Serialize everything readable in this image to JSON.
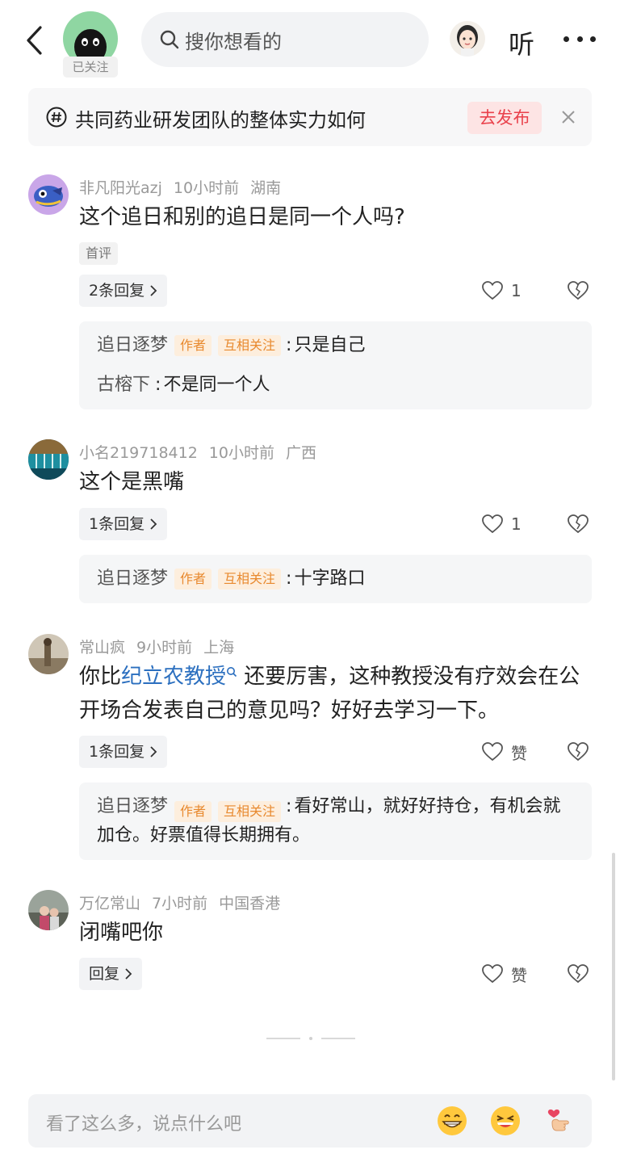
{
  "header": {
    "follow_badge": "已关注",
    "search_placeholder": "搜你想看的",
    "listen_label": "听"
  },
  "topic": {
    "text": "共同药业研发团队的整体实力如何",
    "publish_label": "去发布"
  },
  "comments": [
    {
      "author": "非凡阳光azj",
      "time": "10小时前",
      "location": "湖南",
      "text": "这个追日和别的追日是同一个人吗?",
      "first_tag": "首评",
      "reply_label": "2条回复",
      "likes": "1",
      "replies": [
        {
          "name": "追日逐梦",
          "tags": [
            "作者",
            "互相关注"
          ],
          "text": "只是自己"
        },
        {
          "name": "古榕下",
          "tags": [],
          "text": "不是同一个人"
        }
      ]
    },
    {
      "author": "小名219718412",
      "time": "10小时前",
      "location": "广西",
      "text": "这个是黑嘴",
      "reply_label": "1条回复",
      "likes": "1",
      "replies": [
        {
          "name": "追日逐梦",
          "tags": [
            "作者",
            "互相关注"
          ],
          "text": "十字路口"
        }
      ]
    },
    {
      "author": "常山疯",
      "time": "9小时前",
      "location": "上海",
      "text_before": "你比",
      "text_link": "纪立农教授",
      "text_after": " 还要厉害，这种教授没有疗效会在公开场合发表自己的意见吗？好好去学习一下。",
      "reply_label": "1条回复",
      "likes": "赞",
      "replies": [
        {
          "name": "追日逐梦",
          "tags": [
            "作者",
            "互相关注"
          ],
          "text": "看好常山，就好好持仓，有机会就加仓。好票值得长期拥有。"
        }
      ]
    },
    {
      "author": "万亿常山",
      "time": "7小时前",
      "location": "中国香港",
      "text": "闭嘴吧你",
      "reply_label": "回复",
      "likes": "赞"
    }
  ],
  "bottom": {
    "input_placeholder": "看了这么多，说点什么吧"
  },
  "colors": {
    "link": "#2b6fbf",
    "publish": "#e9414b",
    "tag": "#e8892e"
  }
}
